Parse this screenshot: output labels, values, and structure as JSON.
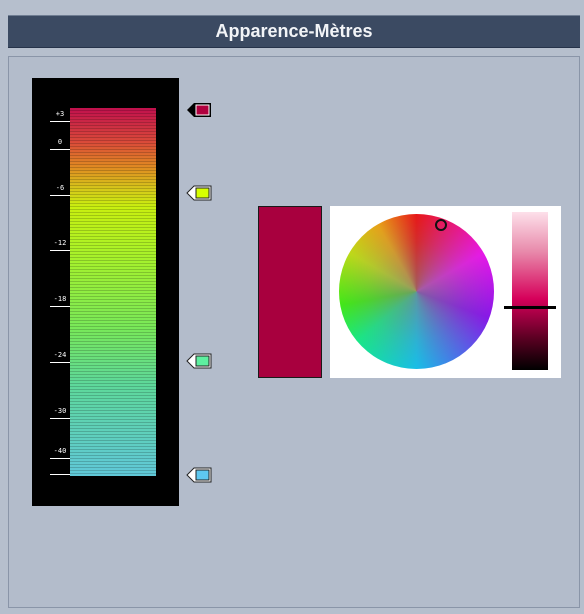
{
  "window": {
    "title": "Apparence-Mètres"
  },
  "meter": {
    "ticks": [
      {
        "label": "+3"
      },
      {
        "label": "0"
      },
      {
        "label": "-6"
      },
      {
        "label": "-12"
      },
      {
        "label": "-18"
      },
      {
        "label": "-24"
      },
      {
        "label": "-30"
      },
      {
        "label": "-40"
      }
    ],
    "markers": [
      {
        "name": "marker-plus3",
        "color": "#b0003e",
        "selected": true
      },
      {
        "name": "marker-minus6",
        "color": "#d8ff00",
        "selected": false
      },
      {
        "name": "marker-minus24",
        "color": "#5ef0a0",
        "selected": false
      },
      {
        "name": "marker-bottom",
        "color": "#5ec8f0",
        "selected": false
      }
    ],
    "gradient_colors": [
      "#c0104d",
      "#e08a22",
      "#c8f010",
      "#78e85a",
      "#60c8d8"
    ]
  },
  "color_picker": {
    "current_color": "#a8003e",
    "brightness_level": 0.6
  }
}
